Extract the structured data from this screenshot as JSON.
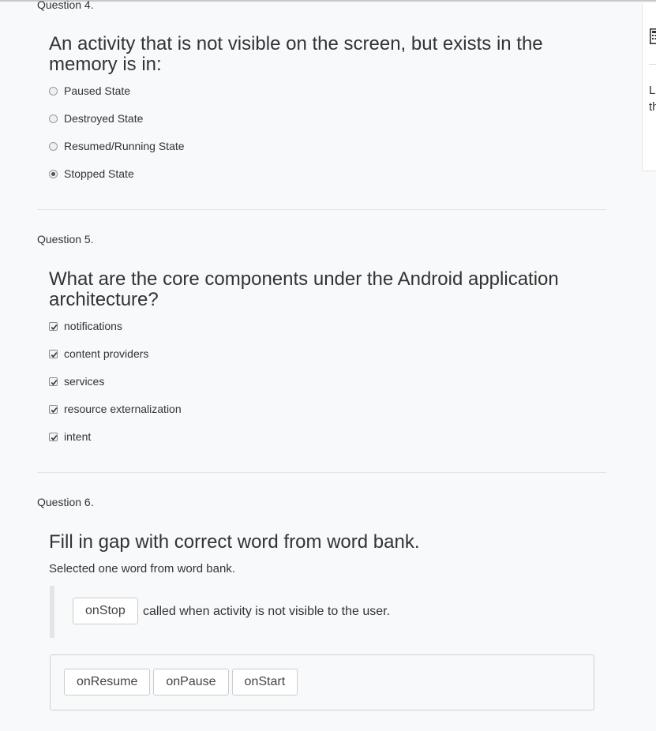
{
  "questions": [
    {
      "label": "Question 4.",
      "text": "An activity that is not visible on the screen, but exists in the memory is in:",
      "options": [
        {
          "label": "Paused State",
          "selected": false
        },
        {
          "label": "Destroyed State",
          "selected": false
        },
        {
          "label": "Resumed/Running State",
          "selected": false
        },
        {
          "label": "Stopped State",
          "selected": true
        }
      ]
    },
    {
      "label": "Question 5.",
      "text": "What are the core components under the Android application architecture?",
      "options": [
        {
          "label": "notifications",
          "checked": true
        },
        {
          "label": "content providers",
          "checked": true
        },
        {
          "label": "services",
          "checked": true
        },
        {
          "label": "resource externalization",
          "checked": true
        },
        {
          "label": "intent",
          "checked": true
        }
      ]
    },
    {
      "label": "Question 6.",
      "text": "Fill in gap with correct word from word bank.",
      "instruction": "Selected one word from word bank.",
      "gap_answer": "onStop",
      "gap_text": "called when activity is not visible to the user.",
      "word_bank": [
        "onResume",
        "onPause",
        "onStart"
      ]
    }
  ],
  "side_panel": {
    "icon": "calculator-icon",
    "text_line1": "L",
    "text_line2": "th"
  }
}
